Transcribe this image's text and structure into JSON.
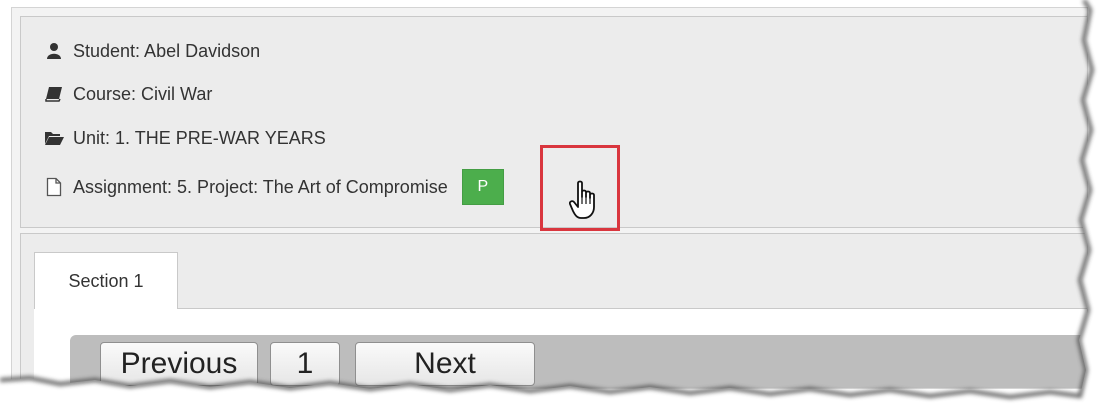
{
  "header": {
    "student": "Student: Abel Davidson",
    "course": "Course: Civil War",
    "unit": "Unit: 1. THE PRE-WAR YEARS",
    "assignment": "Assignment: 5. Project: The Art of Compromise",
    "status_button": "P"
  },
  "icons": {
    "student": "user-icon",
    "course": "book-icon",
    "unit": "folder-open-icon",
    "assignment": "file-icon"
  },
  "colors": {
    "status_green": "#4cae4c",
    "highlight_red": "#d9363e"
  },
  "tabs": [
    {
      "label": "Section 1"
    }
  ],
  "pager": {
    "previous": "Previous",
    "page": "1",
    "next": "Next"
  }
}
